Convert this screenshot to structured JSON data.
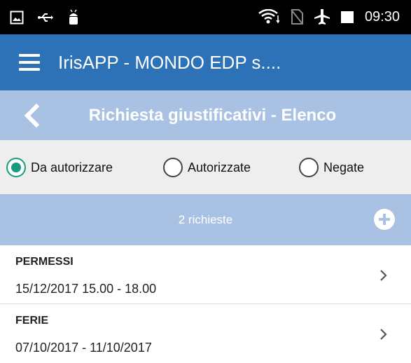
{
  "status_bar": {
    "time": "09:30",
    "icons_left": [
      "gallery-icon",
      "usb-icon",
      "android-debug-icon"
    ],
    "icons_right": [
      "wifi-icon",
      "no-sim-icon",
      "airplane-icon",
      "battery-icon"
    ]
  },
  "app_bar": {
    "title": "IrisAPP - MONDO EDP s....",
    "color": "#2d71b7"
  },
  "sub_header": {
    "title": "Richiesta giustificativi - Elenco",
    "color": "#a9c1e2"
  },
  "filters": {
    "options": [
      {
        "label": "Da autorizzare",
        "selected": true
      },
      {
        "label": "Autorizzate",
        "selected": false
      },
      {
        "label": "Negate",
        "selected": false
      }
    ],
    "accent": "#1a9b7f"
  },
  "summary": {
    "count_label": "2 richieste"
  },
  "requests": [
    {
      "type": "PERMESSI",
      "dates": "15/12/2017 15.00 - 18.00"
    },
    {
      "type": "FERIE",
      "dates": "07/10/2017 - 11/10/2017"
    }
  ]
}
